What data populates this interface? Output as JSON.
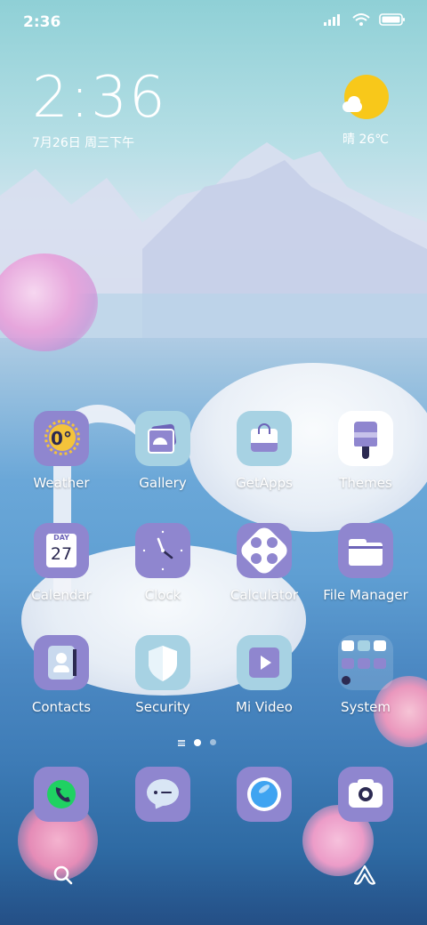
{
  "status": {
    "time": "2:36"
  },
  "clock_widget": {
    "time": "2:36",
    "date": "7月26日 周三下午"
  },
  "weather_widget": {
    "text": "晴 26℃"
  },
  "apps": [
    {
      "label": "Weather",
      "icon": "weather-icon",
      "temp": "0°"
    },
    {
      "label": "Gallery",
      "icon": "gallery-icon"
    },
    {
      "label": "GetApps",
      "icon": "getapps-icon"
    },
    {
      "label": "Themes",
      "icon": "themes-icon"
    },
    {
      "label": "Calendar",
      "icon": "calendar-icon",
      "day_word": "DAY",
      "day_num": "27"
    },
    {
      "label": "Clock",
      "icon": "clock-icon"
    },
    {
      "label": "Calculator",
      "icon": "calculator-icon"
    },
    {
      "label": "File Manager",
      "icon": "folder-icon"
    },
    {
      "label": "Contacts",
      "icon": "contacts-icon"
    },
    {
      "label": "Security",
      "icon": "shield-icon"
    },
    {
      "label": "Mi Video",
      "icon": "video-icon"
    },
    {
      "label": "System",
      "icon": "system-folder-icon"
    }
  ],
  "pager": {
    "pages": 2,
    "active": 1
  },
  "dock": [
    {
      "icon": "phone-icon"
    },
    {
      "icon": "messages-icon"
    },
    {
      "icon": "browser-icon"
    },
    {
      "icon": "camera-icon"
    }
  ],
  "colors": {
    "accent": "#8f86cf",
    "light": "#a7d2e3",
    "phone": "#1fd162"
  }
}
